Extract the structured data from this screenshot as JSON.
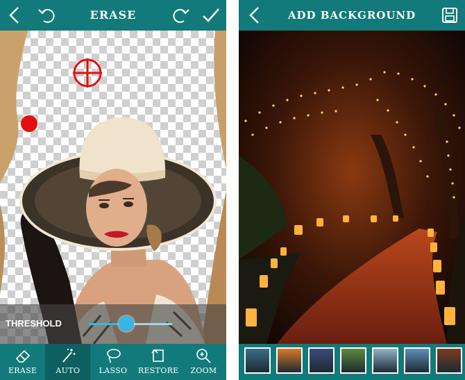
{
  "erase_screen": {
    "title": "ERASE",
    "threshold": {
      "label": "THRESHOLD",
      "value": 0.45
    },
    "tools": [
      {
        "label": "ERASE",
        "icon": "eraser-icon",
        "active": false
      },
      {
        "label": "AUTO",
        "icon": "magic-wand-icon",
        "active": true
      },
      {
        "label": "LASSO",
        "icon": "lasso-icon",
        "active": false
      },
      {
        "label": "RESTORE",
        "icon": "restore-icon",
        "active": false
      },
      {
        "label": "ZOOM",
        "icon": "zoom-icon",
        "active": false
      }
    ],
    "markers": {
      "target": "crosshair-icon",
      "dot": "red-dot"
    }
  },
  "background_screen": {
    "title": "ADD BACKGROUND",
    "thumbnails": [
      {
        "name": "thumb-lake",
        "color": "#3b6e86"
      },
      {
        "name": "thumb-sunset",
        "color": "#d9782a"
      },
      {
        "name": "thumb-lights",
        "color": "#3a4a7a"
      },
      {
        "name": "thumb-meadow",
        "color": "#5e8a3a"
      },
      {
        "name": "thumb-forest",
        "color": "#8fb4c8"
      },
      {
        "name": "thumb-mountains",
        "color": "#5f8fb8"
      },
      {
        "name": "thumb-path",
        "color": "#7a3c1e"
      }
    ]
  },
  "colors": {
    "teal": "#127a7a",
    "teal_dark": "#0e5f5f",
    "slider": "#35b7e6",
    "marker_red": "#e31010"
  }
}
